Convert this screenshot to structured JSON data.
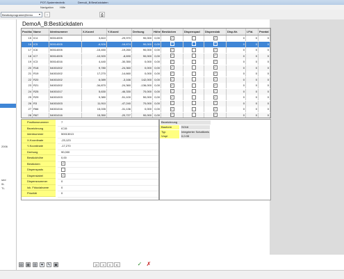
{
  "window": {
    "title_left": "POT-Systemtechnik",
    "title_tab": "DemoA_B:Bestückdaten"
  },
  "menu": {
    "items": [
      "Navigation",
      "Hilfe"
    ]
  },
  "toolbar": {
    "program_combo_value": "Bestückprogramm|Demo"
  },
  "left_pane": {
    "labels": [
      "2006",
      "sed",
      "0L",
      "TL"
    ]
  },
  "grid": {
    "title": "DemoA_B:Bestückdaten",
    "columns": [
      "Position",
      "Name",
      "Identnummer",
      "X-Koord",
      "Y-Koord",
      "Drehung",
      "Höhe",
      "Bestücken",
      "Dispenspad",
      "Dispenslab",
      "Disp.Nr.",
      "I.Fid.",
      "Prantal"
    ],
    "rows": [
      {
        "pos": "15",
        "name": "IC4",
        "id": "50014005",
        "x": "3,810",
        "y": "-29,970",
        "rot": "90,000",
        "h": "0,00",
        "b": true,
        "dp": false,
        "dl": true,
        "dn": "0",
        "fid": "0",
        "pr": "0"
      },
      {
        "pos": "16",
        "name": "IC5",
        "id": "50014005",
        "x": "-6,526",
        "y": "-16,674",
        "rot": "90,000",
        "h": "0,00",
        "b": true,
        "dp": false,
        "dl": true,
        "dn": "0",
        "fid": "0",
        "pr": "0"
      },
      {
        "pos": "17",
        "name": "IC6",
        "id": "50014005",
        "x": "-15,450",
        "y": "-19,260",
        "rot": "90,000",
        "h": "0,00",
        "b": true,
        "dp": false,
        "dl": true,
        "dn": "0",
        "fid": "0",
        "pr": "0"
      },
      {
        "pos": "18",
        "name": "IC7",
        "id": "50014005",
        "x": "-10,920",
        "y": "-8,690",
        "rot": "90,000",
        "h": "0,00",
        "b": true,
        "dp": false,
        "dl": true,
        "dn": "0",
        "fid": "0",
        "pr": "0"
      },
      {
        "pos": "19",
        "name": "IC3",
        "id": "50014016",
        "x": "4,440",
        "y": "-30,350",
        "rot": "0,000",
        "h": "0,00",
        "b": true,
        "dp": false,
        "dl": true,
        "dn": "0",
        "fid": "0",
        "pr": "0"
      },
      {
        "pos": "20",
        "name": "R18",
        "id": "54001002",
        "x": "9,780",
        "y": "-24,360",
        "rot": "0,000",
        "h": "0,00",
        "b": true,
        "dp": false,
        "dl": true,
        "dn": "0",
        "fid": "0",
        "pr": "0"
      },
      {
        "pos": "21",
        "name": "R19",
        "id": "54001002",
        "x": "17,270",
        "y": "-14,660",
        "rot": "0,000",
        "h": "0,00",
        "b": true,
        "dp": false,
        "dl": true,
        "dn": "0",
        "fid": "0",
        "pr": "0"
      },
      {
        "pos": "22",
        "name": "R20",
        "id": "54001002",
        "x": "6,089",
        "y": "-3,166",
        "rot": "142,000",
        "h": "0,00",
        "b": true,
        "dp": false,
        "dl": true,
        "dn": "0",
        "fid": "0",
        "pr": "0"
      },
      {
        "pos": "23",
        "name": "R21",
        "id": "54001002",
        "x": "-34,870",
        "y": "-24,360",
        "rot": "-136,000",
        "h": "0,00",
        "b": true,
        "dp": false,
        "dl": true,
        "dn": "0",
        "fid": "0",
        "pr": "0"
      },
      {
        "pos": "24",
        "name": "R25",
        "id": "54001017",
        "x": "5,630",
        "y": "-46,330",
        "rot": "70,000",
        "h": "0,00",
        "b": true,
        "dp": false,
        "dl": true,
        "dn": "0",
        "fid": "0",
        "pr": "0"
      },
      {
        "pos": "25",
        "name": "R29",
        "id": "54001003",
        "x": "9,380",
        "y": "-51,100",
        "rot": "50,000",
        "h": "0,00",
        "b": true,
        "dp": false,
        "dl": true,
        "dn": "0",
        "fid": "0",
        "pr": "0"
      },
      {
        "pos": "26",
        "name": "R3",
        "id": "54001003",
        "x": "11,910",
        "y": "-47,240",
        "rot": "70,000",
        "h": "0,00",
        "b": true,
        "dp": false,
        "dl": true,
        "dn": "0",
        "fid": "0",
        "pr": "0"
      },
      {
        "pos": "27",
        "name": "R66",
        "id": "54001016",
        "x": "15,035",
        "y": "-31,136",
        "rot": "0,000",
        "h": "0,00",
        "b": true,
        "dp": false,
        "dl": true,
        "dn": "0",
        "fid": "0",
        "pr": "0"
      },
      {
        "pos": "28",
        "name": "R67",
        "id": "54001016",
        "x": "15,350",
        "y": "-20,727",
        "rot": "90,000",
        "h": "0,00",
        "b": true,
        "dp": false,
        "dl": true,
        "dn": "0",
        "fid": "0",
        "pr": "0"
      }
    ],
    "selected_index": 1
  },
  "details": {
    "fields": [
      {
        "label": "Positionsnummer",
        "value": "7",
        "checkbox": null
      },
      {
        "label": "Bezeichnung",
        "value": "IC15",
        "checkbox": null
      },
      {
        "label": "Identnummer",
        "value": "50013013",
        "checkbox": null
      },
      {
        "label": "X-Koordinate",
        "value": "-23,123",
        "checkbox": null
      },
      {
        "label": "Y-Koordinate",
        "value": "-17,270",
        "checkbox": null
      },
      {
        "label": "Drehung",
        "value": "90,000",
        "checkbox": null
      },
      {
        "label": "Bestückhöhe",
        "value": "0,00",
        "checkbox": null
      },
      {
        "label": "Bestücken",
        "value": "",
        "checkbox": true
      },
      {
        "label": "Dispenspads",
        "value": "",
        "checkbox": false
      },
      {
        "label": "Dispenslabel",
        "value": "",
        "checkbox": true
      },
      {
        "label": "Dispensnummer",
        "value": "0",
        "checkbox": null
      },
      {
        "label": "lok. Fiducialname",
        "value": "0",
        "checkbox": null
      },
      {
        "label": "Priorität",
        "value": "0",
        "checkbox": null
      }
    ]
  },
  "component_info": {
    "title": "Bezeichnung",
    "rows": [
      {
        "label": "Bauform",
        "value": "SO16"
      },
      {
        "label": "Typ",
        "value": "Integrierter Schaltkreis"
      },
      {
        "label": "Vmpl",
        "value": "0,0:35"
      }
    ]
  },
  "accent_color": "#3f86d6",
  "label_color": "#ffff80"
}
